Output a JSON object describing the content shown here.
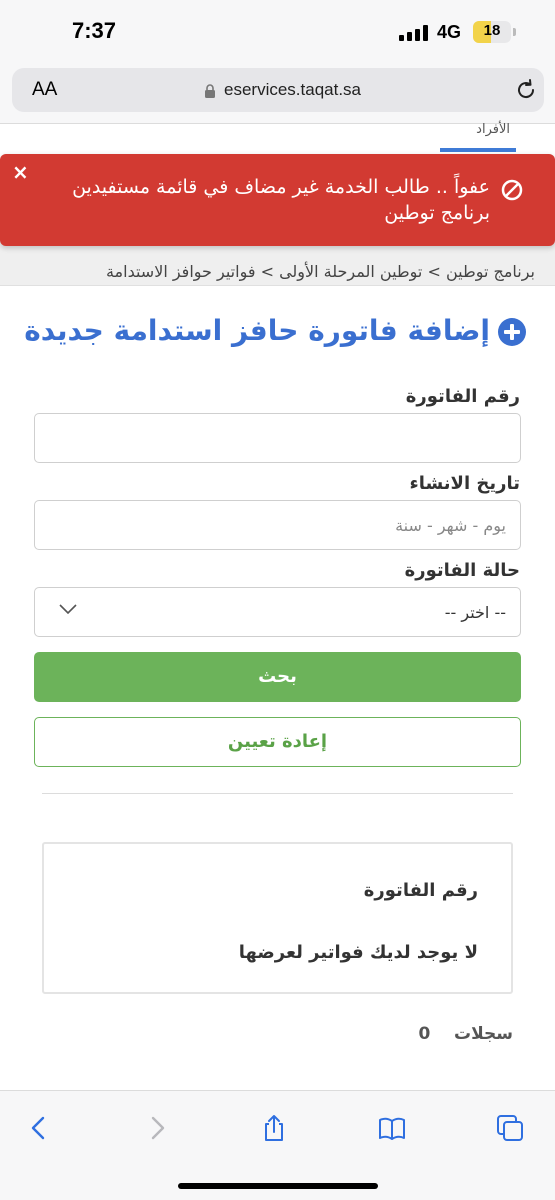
{
  "status_bar": {
    "time": "7:37",
    "network": "4G",
    "battery": "18"
  },
  "browser": {
    "aa_label": "AA",
    "domain": "eservices.taqat.sa"
  },
  "page": {
    "tab_label": "الأفراد",
    "breadcrumb": "برنامج توطين > توطين المرحلة الأولى > فواتير حوافز الاستدامة"
  },
  "alert": {
    "close": "×",
    "message": "عفواً .. طالب الخدمة غير مضاف في قائمة مستفيدين برنامج توطين"
  },
  "title": "إضافة فاتورة حافز استدامة جديدة",
  "form": {
    "invoice_number_label": "رقم الفاتورة",
    "invoice_number_value": "",
    "created_date_label": "تاريخ الانشاء",
    "created_date_placeholder": "يوم - شهر - سنة",
    "status_label": "حالة الفاتورة",
    "status_selected": "-- اختر --",
    "search_button": "بحث",
    "reset_button": "إعادة تعيين"
  },
  "results": {
    "column_header": "رقم الفاتورة",
    "empty_message": "لا يوجد لديك فواتير لعرضها",
    "records_count": "0",
    "records_label": "سجلات"
  },
  "toolbar": {
    "icons": [
      "back-icon",
      "forward-icon",
      "share-icon",
      "bookmarks-icon",
      "tabs-icon"
    ]
  },
  "colors": {
    "accent": "#3a6fd0",
    "alert": "#d23a32",
    "success": "#6cb35a"
  }
}
